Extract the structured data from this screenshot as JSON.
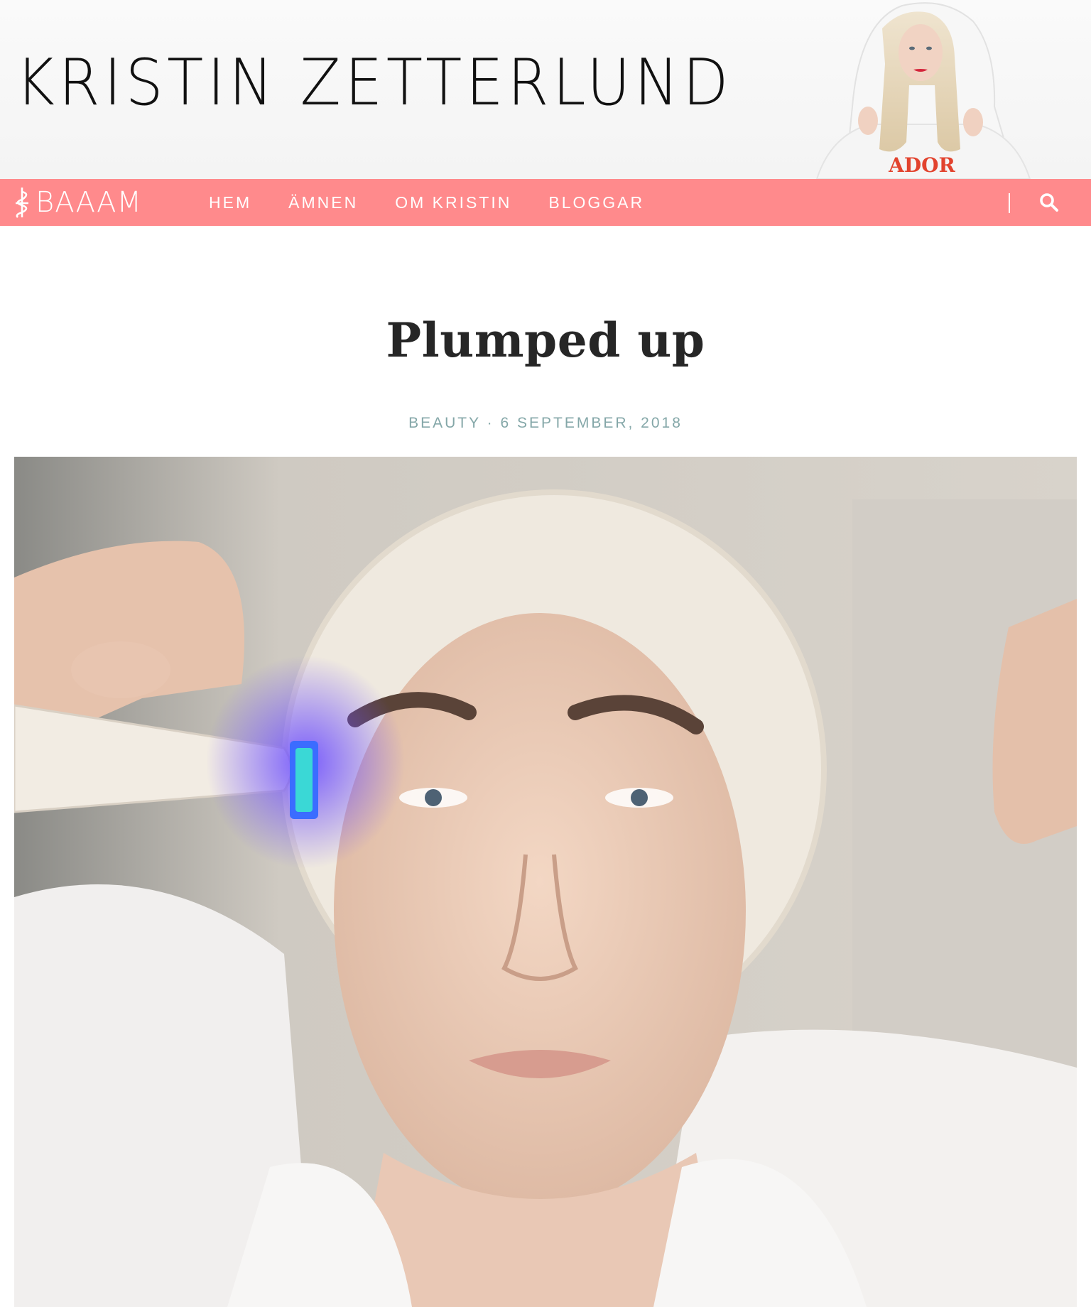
{
  "header": {
    "site_title": "KRISTIN ZETTERLUND",
    "photo_shirt_text": "ADOR"
  },
  "nav": {
    "brand": "BAAAM",
    "links": [
      "HEM",
      "ÄMNEN",
      "OM KRISTIN",
      "BLOGGAR"
    ],
    "search_icon": "search-icon",
    "color": "#ff8a8c"
  },
  "post": {
    "title": "Plumped up",
    "category": "BEAUTY",
    "separator": "·",
    "date": "6 SEPTEMBER, 2018"
  }
}
